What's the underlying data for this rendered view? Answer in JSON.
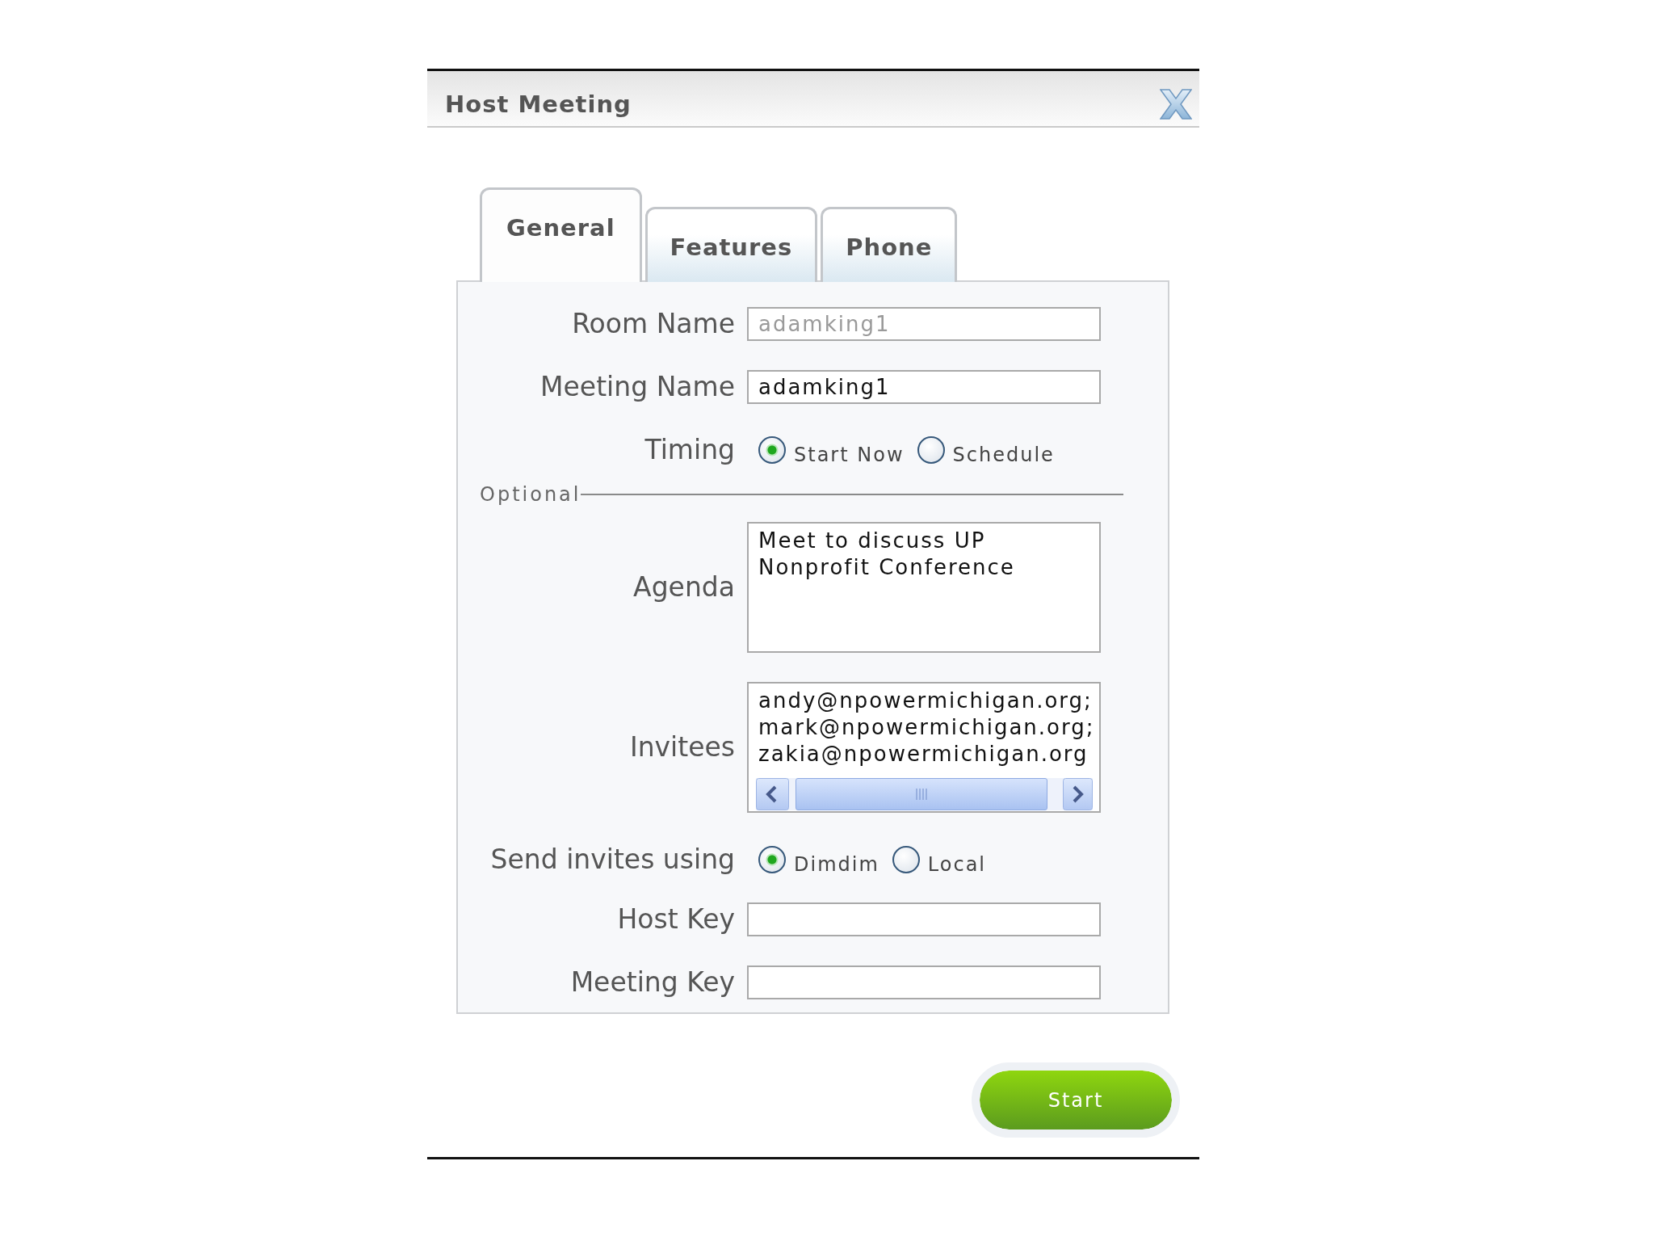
{
  "window": {
    "title": "Host Meeting"
  },
  "tabs": [
    {
      "label": "General",
      "selected": true
    },
    {
      "label": "Features",
      "selected": false
    },
    {
      "label": "Phone",
      "selected": false
    }
  ],
  "form": {
    "rows": [
      {
        "kind": "text",
        "label": "Room Name",
        "value": "adamking1",
        "disabled": true
      },
      {
        "kind": "text",
        "label": "Meeting Name",
        "value": "adamking1",
        "disabled": false
      },
      {
        "kind": "radio",
        "label": "Timing",
        "options": [
          {
            "label": "Start Now",
            "selected": true
          },
          {
            "label": "Schedule",
            "selected": false
          }
        ]
      },
      {
        "kind": "section",
        "label": "Optional"
      },
      {
        "kind": "textarea",
        "label": "Agenda",
        "value": "Meet to discuss UP Nonprofit Conference"
      },
      {
        "kind": "scrolltext",
        "label": "Invitees",
        "value": "andy@npowermichigan.org;\nmark@npowermichigan.org;\nzakia@npowermichigan.org"
      },
      {
        "kind": "radio",
        "label": "Send invites using",
        "options": [
          {
            "label": "Dimdim",
            "selected": true
          },
          {
            "label": "Local",
            "selected": false
          }
        ]
      },
      {
        "kind": "text",
        "label": "Host Key"
      },
      {
        "kind": "text",
        "label": "Meeting Key"
      }
    ]
  },
  "buttons": [
    {
      "label": "Start"
    }
  ]
}
